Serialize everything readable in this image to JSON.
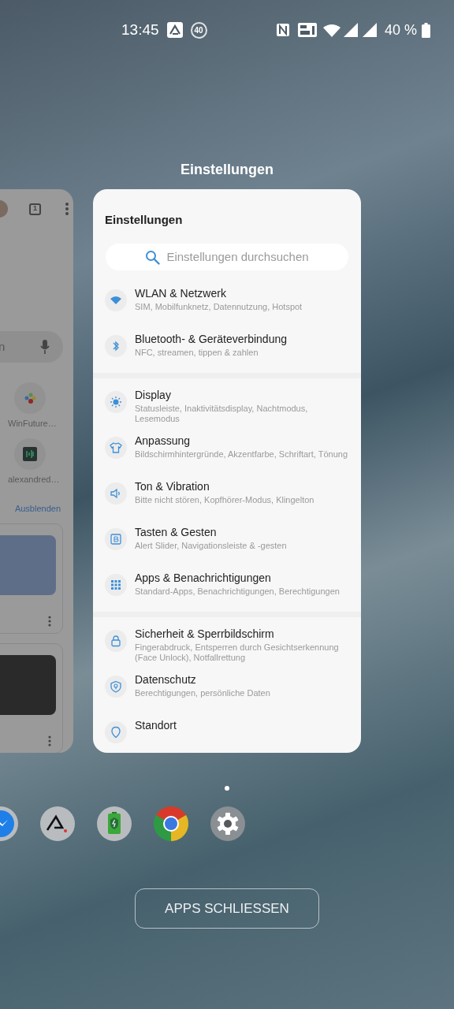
{
  "status_bar": {
    "time": "13:45",
    "badge": "40",
    "battery": "40 %"
  },
  "background_app": {
    "tab_count": "1",
    "search_text": "n",
    "shortcuts": [
      {
        "kind": "dots",
        "label": "WinFuture…"
      },
      {
        "kind": "bars",
        "label": "alexandred…"
      }
    ],
    "hide_link": "Ausblenden",
    "cards": [
      {
        "kind": "photo"
      },
      {
        "kind": "photo"
      }
    ]
  },
  "active_app": {
    "label": "Einstellungen",
    "title": "Einstellungen",
    "search": {
      "placeholder": "Einstellungen durchsuchen"
    },
    "sections": [
      {
        "items": [
          {
            "kind": "wifi",
            "title": "WLAN & Netzwerk",
            "subtitle": "SIM, Mobilfunknetz, Datennutzung, Hotspot"
          },
          {
            "kind": "bluetooth",
            "title": "Bluetooth- & Geräteverbindung",
            "subtitle": "NFC, streamen, tippen & zahlen"
          }
        ]
      },
      {
        "items": [
          {
            "kind": "display",
            "title": "Display",
            "subtitle": "Statusleiste, Inaktivitätsdisplay, Nachtmodus, Lesemodus"
          },
          {
            "kind": "shirt",
            "title": "Anpassung",
            "subtitle": "Bildschirmhintergründe, Akzentfarbe, Schriftart, Tönung"
          },
          {
            "kind": "sound",
            "title": "Ton & Vibration",
            "subtitle": "Bitte nicht stören, Kopfhörer-Modus, Klingelton"
          },
          {
            "kind": "buttons",
            "title": "Tasten & Gesten",
            "subtitle": "Alert Slider, Navigationsleiste & -gesten"
          },
          {
            "kind": "apps",
            "title": "Apps & Benachrichtigungen",
            "subtitle": "Standard-Apps, Benachrichtigungen, Berechtigungen"
          }
        ]
      },
      {
        "items": [
          {
            "kind": "lock",
            "title": "Sicherheit & Sperrbildschirm",
            "subtitle": "Fingerabdruck, Entsperren durch Gesichtserkennung (Face Unlock), Notfallrettung"
          },
          {
            "kind": "shield",
            "title": "Datenschutz",
            "subtitle": "Berechtigungen, persönliche Daten"
          },
          {
            "kind": "location",
            "title": "Standort"
          }
        ]
      }
    ]
  },
  "dock": [
    {
      "kind": "messenger"
    },
    {
      "kind": "letter-a"
    },
    {
      "kind": "battery"
    },
    {
      "kind": "chrome"
    },
    {
      "kind": "gear"
    }
  ],
  "close_button": "APPS SCHLIESSEN"
}
